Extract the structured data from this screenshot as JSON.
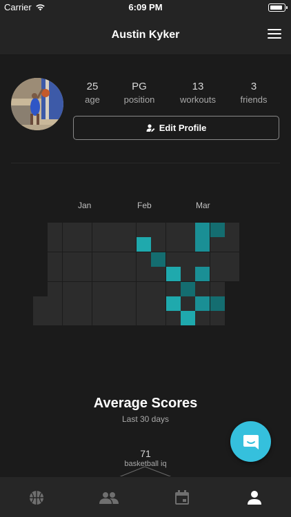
{
  "status_bar": {
    "carrier": "Carrier",
    "time": "6:09 PM"
  },
  "header": {
    "title": "Austin Kyker",
    "menu_icon": "hamburger-menu-icon"
  },
  "profile": {
    "stats": [
      {
        "value": "25",
        "label": "age"
      },
      {
        "value": "PG",
        "label": "position"
      },
      {
        "value": "13",
        "label": "workouts"
      },
      {
        "value": "3",
        "label": "friends"
      }
    ],
    "edit_button": "Edit Profile",
    "edit_icon": "user-edit-icon"
  },
  "heatmap": {
    "months": [
      "Jan",
      "Feb",
      "Mar"
    ],
    "base_color": "#2c2c2c",
    "active_colors": [
      "#1a8f95",
      "#146d70",
      "#1fa9ad"
    ],
    "active_cells": [
      {
        "week": 11,
        "day": 0
      },
      {
        "week": 12,
        "day": 0
      },
      {
        "week": 7,
        "day": 1
      },
      {
        "week": 11,
        "day": 1
      },
      {
        "week": 8,
        "day": 2
      },
      {
        "week": 9,
        "day": 3
      },
      {
        "week": 11,
        "day": 3
      },
      {
        "week": 10,
        "day": 4
      },
      {
        "week": 9,
        "day": 5
      },
      {
        "week": 11,
        "day": 5
      },
      {
        "week": 12,
        "day": 5
      },
      {
        "week": 10,
        "day": 6
      }
    ]
  },
  "scores": {
    "title": "Average Scores",
    "subtitle": "Last 30 days",
    "items": [
      {
        "value": "71",
        "label": "basketball iq"
      }
    ]
  },
  "chat_button": {
    "icon": "chat-bubble-icon",
    "color": "#35c0dd"
  },
  "tab_bar": {
    "tabs": [
      {
        "icon": "basketball-icon",
        "active": false
      },
      {
        "icon": "friends-icon",
        "active": false
      },
      {
        "icon": "calendar-icon",
        "active": false
      },
      {
        "icon": "profile-icon",
        "active": true
      }
    ]
  }
}
